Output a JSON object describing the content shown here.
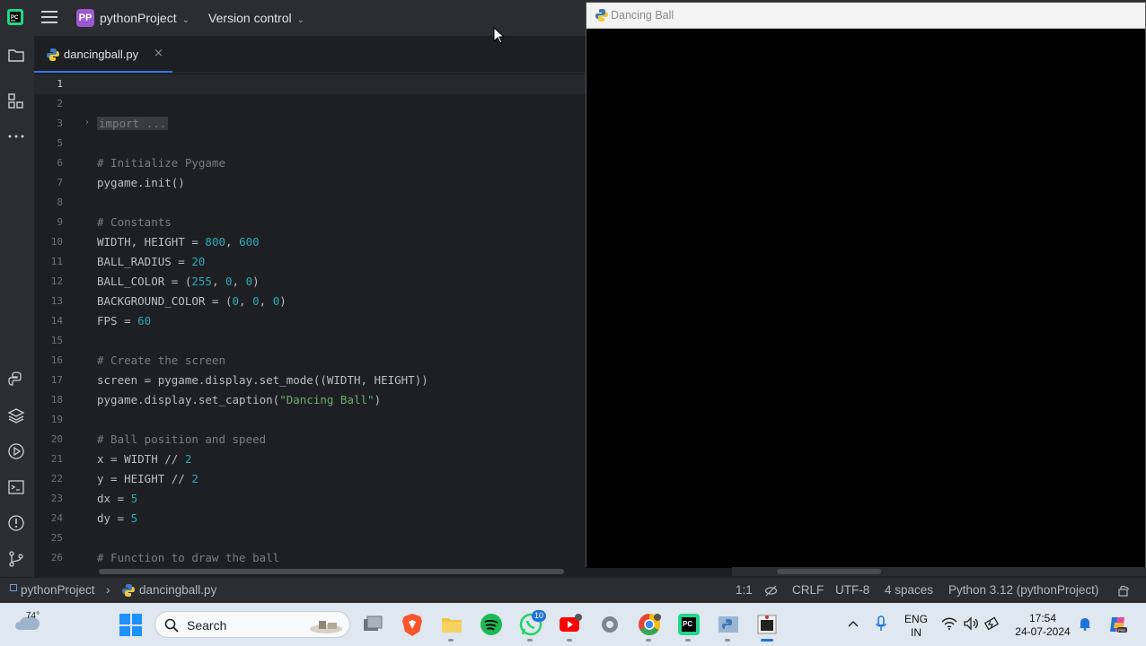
{
  "titlebar": {
    "project_badge": "PP",
    "project_name": "pythonProject",
    "version_control": "Version control"
  },
  "toolstrip": {
    "icons": [
      "folder-icon",
      "structure-icon",
      "more-icon",
      "python-console-icon",
      "layers-icon",
      "run-icon",
      "terminal-icon",
      "problems-icon",
      "git-icon"
    ]
  },
  "editor": {
    "tab_label": "dancingball.py",
    "tab_close": "×",
    "line_numbers": [
      "1",
      "2",
      "3",
      "5",
      "6",
      "7",
      "8",
      "9",
      "10",
      "11",
      "12",
      "13",
      "14",
      "15",
      "16",
      "17",
      "18",
      "19",
      "20",
      "21",
      "22",
      "23",
      "24",
      "25",
      "26"
    ],
    "lines": {
      "l3_fold": "import ...",
      "l6": "# Initialize Pygame",
      "l7": "pygame.init()",
      "l9": "# Constants",
      "l10_a": "WIDTH, HEIGHT = ",
      "l10_b": "800",
      "l10_c": ", ",
      "l10_d": "600",
      "l11_a": "BALL_RADIUS = ",
      "l11_b": "20",
      "l12_a": "BALL_COLOR = (",
      "l12_b": "255",
      "l12_c": ", ",
      "l12_d": "0",
      "l12_e": ", ",
      "l12_f": "0",
      "l12_g": ")",
      "l13_a": "BACKGROUND_COLOR = (",
      "l13_b": "0",
      "l13_c": ", ",
      "l13_d": "0",
      "l13_e": ", ",
      "l13_f": "0",
      "l13_g": ")",
      "l14_a": "FPS = ",
      "l14_b": "60",
      "l16": "# Create the screen",
      "l17": "screen = pygame.display.set_mode((WIDTH, HEIGHT))",
      "l18_a": "pygame.display.set_caption(",
      "l18_b": "\"Dancing Ball\"",
      "l18_c": ")",
      "l20": "# Ball position and speed",
      "l21_a": "x = WIDTH // ",
      "l21_b": "2",
      "l22_a": "y = HEIGHT // ",
      "l22_b": "2",
      "l23_a": "dx = ",
      "l23_b": "5",
      "l24_a": "dy = ",
      "l24_b": "5",
      "l26": "# Function to draw the ball"
    }
  },
  "statusbar": {
    "project": "pythonProject",
    "separator": "›",
    "file": "dancingball.py",
    "position": "1:1",
    "line_ending": "CRLF",
    "encoding": "UTF-8",
    "indent": "4 spaces",
    "interpreter": "Python 3.12 (pythonProject)"
  },
  "pygame_window": {
    "title": "Dancing Ball"
  },
  "taskbar": {
    "temperature": "74°",
    "search_placeholder": "Search",
    "whatsapp_badge": "10",
    "language_line1": "ENG",
    "language_line2": "IN",
    "time": "17:54",
    "date": "24-07-2024",
    "accent": "#1e74d8"
  }
}
